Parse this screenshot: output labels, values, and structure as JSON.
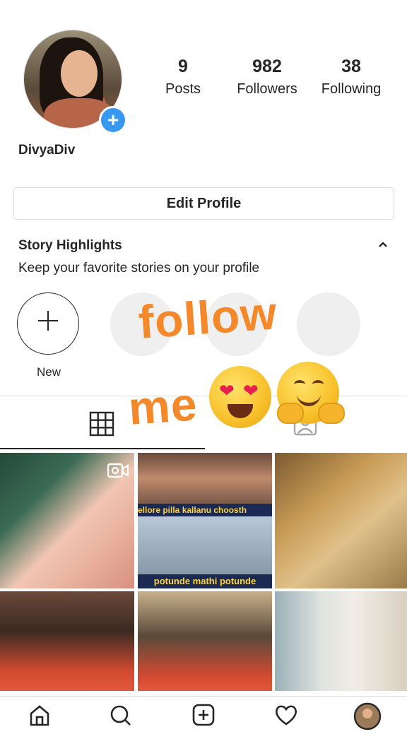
{
  "profile": {
    "username": "DivyaDiv",
    "stats": [
      {
        "value": "9",
        "label": "Posts"
      },
      {
        "value": "982",
        "label": "Followers"
      },
      {
        "value": "38",
        "label": "Following"
      }
    ],
    "edit_profile_label": "Edit Profile"
  },
  "highlights": {
    "title": "Story Highlights",
    "subtitle": "Keep your favorite stories on your profile",
    "new_label": "New"
  },
  "overlay": {
    "line1": "follow",
    "line2": "me"
  },
  "grid": {
    "post2_banner_top": "ellore pilla kallanu choosth",
    "post2_banner_bottom": "potunde mathi potunde"
  },
  "colors": {
    "accent_blue": "#3897f0",
    "overlay_orange": "#f4892b",
    "divider": "#dbdbdb"
  },
  "icons": {
    "add_story": "plus-circle-icon",
    "grid_tab": "grid-icon",
    "tagged_tab": "tagged-person-icon",
    "collapse": "chevron-up-icon",
    "nav": [
      "home-icon",
      "search-icon",
      "add-post-icon",
      "heart-icon",
      "profile-avatar-icon"
    ]
  }
}
